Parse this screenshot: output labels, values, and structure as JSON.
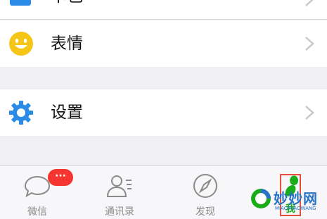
{
  "rows": {
    "cards": {
      "label": "卡包",
      "icon": "card-wallet-icon"
    },
    "emoji": {
      "label": "表情",
      "icon": "smiley-face-icon"
    },
    "settings": {
      "label": "设置",
      "icon": "gear-icon"
    }
  },
  "tabbar": {
    "tabs": [
      {
        "label": "微信",
        "icon": "chat-bubble-icon",
        "badge": "···"
      },
      {
        "label": "通讯录",
        "icon": "contacts-icon"
      },
      {
        "label": "发现",
        "icon": "compass-icon"
      },
      {
        "label": "我",
        "icon": "person-icon",
        "active": true
      }
    ]
  },
  "watermark": {
    "text": "妙妙网",
    "sub": "MIAOMIAOWANG"
  },
  "colors": {
    "accent": "#1aad19",
    "badge": "#f43530",
    "gear": "#2a8ce6",
    "smiley": "#f5c518",
    "highlight": "#e5503c"
  }
}
